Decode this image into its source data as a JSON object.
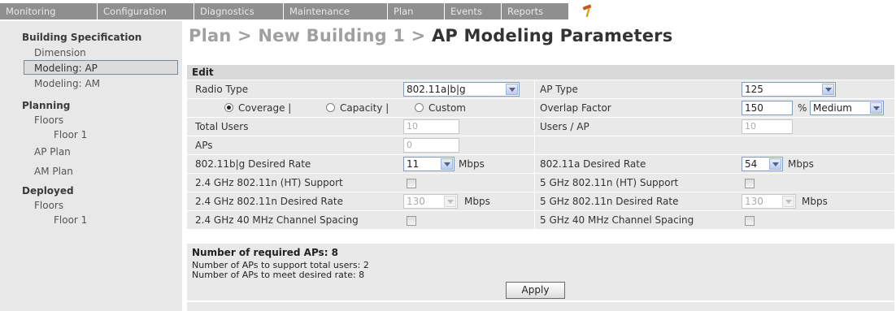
{
  "nav": {
    "tabs": [
      "Monitoring",
      "Configuration",
      "Diagnostics",
      "Maintenance",
      "Plan",
      "Events",
      "Reports"
    ],
    "icon": "hammer-icon"
  },
  "sidebar": {
    "building_spec": "Building Specification",
    "dimension": "Dimension",
    "modeling_ap": "Modeling: AP",
    "modeling_am": "Modeling: AM",
    "planning": "Planning",
    "planning_floors": "Floors",
    "planning_floor1": "Floor 1",
    "ap_plan": "AP Plan",
    "am_plan": "AM Plan",
    "deployed": "Deployed",
    "deployed_floors": "Floors",
    "deployed_floor1": "Floor 1"
  },
  "title": {
    "crumb": "Plan > New Building 1 > ",
    "current": "AP Modeling Parameters"
  },
  "edit": {
    "header": "Edit",
    "radio_type_label": "Radio Type",
    "radio_type_value": "802.11a|b|g",
    "ap_type_label": "AP Type",
    "ap_type_value": "125",
    "coverage": "Coverage |",
    "capacity": "Capacity |",
    "custom": "Custom",
    "overlap_label": "Overlap Factor",
    "overlap_value": "150",
    "overlap_unit": "%",
    "overlap_level": "Medium",
    "total_users_label": "Total Users",
    "total_users_value": "10",
    "users_per_ap_label": "Users / AP",
    "users_per_ap_value": "10",
    "aps_label": "APs",
    "aps_value": "0",
    "bg_rate_label": "802.11b|g Desired Rate",
    "bg_rate_value": "11",
    "a_rate_label": "802.11a Desired Rate",
    "a_rate_value": "54",
    "unit_mbps": "Mbps",
    "ht24_label": "2.4 GHz 802.11n (HT) Support",
    "ht5_label": "5 GHz 802.11n (HT) Support",
    "n24_rate_label": "2.4 GHz 802.11n Desired Rate",
    "n24_rate_value": "130",
    "n5_rate_label": "5 GHz 802.11n Desired Rate",
    "n5_rate_value": "130",
    "ch24_label": "2.4 GHz 40 MHz Channel Spacing",
    "ch5_label": "5 GHz 40 MHz Channel Spacing"
  },
  "summary": {
    "required": "Number of required APs: 8",
    "users_line": "Number of APs to support total users: 2",
    "rate_line": "Number of APs to meet desired rate: 8"
  },
  "apply_label": "Apply"
}
